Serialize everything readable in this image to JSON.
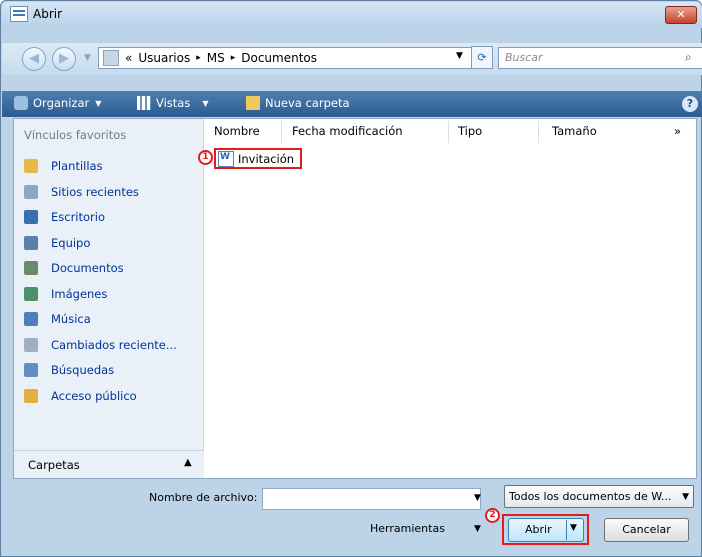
{
  "window": {
    "title": "Abrir",
    "close_glyph": "✕"
  },
  "address": {
    "crumb_prefix": "«",
    "crumbs": [
      "Usuarios",
      "MS",
      "Documentos"
    ],
    "separator": "▸",
    "search_placeholder": "Buscar"
  },
  "toolbar": {
    "organize": "Organizar",
    "views": "Vistas",
    "new_folder": "Nueva carpeta",
    "help": "?"
  },
  "sidebar": {
    "heading": "Vínculos favoritos",
    "items": [
      {
        "label": "Plantillas",
        "icon": "templates-folder-icon",
        "color": "#e7b84a"
      },
      {
        "label": "Sitios recientes",
        "icon": "recent-places-icon",
        "color": "#8fa6bf"
      },
      {
        "label": "Escritorio",
        "icon": "desktop-icon",
        "color": "#3a6fb0"
      },
      {
        "label": "Equipo",
        "icon": "computer-icon",
        "color": "#5a7fa8"
      },
      {
        "label": "Documentos",
        "icon": "documents-icon",
        "color": "#6b8a6b"
      },
      {
        "label": "Imágenes",
        "icon": "pictures-icon",
        "color": "#4f8f6b"
      },
      {
        "label": "Música",
        "icon": "music-icon",
        "color": "#4f7fb8"
      },
      {
        "label": "Cambiados reciente...",
        "icon": "recently-changed-icon",
        "color": "#9fb0c2"
      },
      {
        "label": "Búsquedas",
        "icon": "searches-icon",
        "color": "#5f8fbf"
      },
      {
        "label": "Acceso público",
        "icon": "public-folder-icon",
        "color": "#e0b040"
      }
    ],
    "folders_label": "Carpetas"
  },
  "file_list": {
    "columns": [
      "Nombre",
      "Fecha modificación",
      "Tipo",
      "Tamaño"
    ],
    "more": "»",
    "files": [
      {
        "name": "Invitación",
        "icon": "word-document-icon"
      }
    ]
  },
  "annotations": {
    "marker_1": "1",
    "marker_2": "2"
  },
  "footer": {
    "filename_label": "Nombre de archivo:",
    "filename_value": "",
    "filetype_value": "Todos los documentos de W...",
    "tools_label": "Herramientas",
    "open_label": "Abrir",
    "cancel_label": "Cancelar"
  },
  "colors": {
    "highlight": "#e01c1c",
    "toolbar": "#3a6ba0",
    "link": "#003399"
  }
}
